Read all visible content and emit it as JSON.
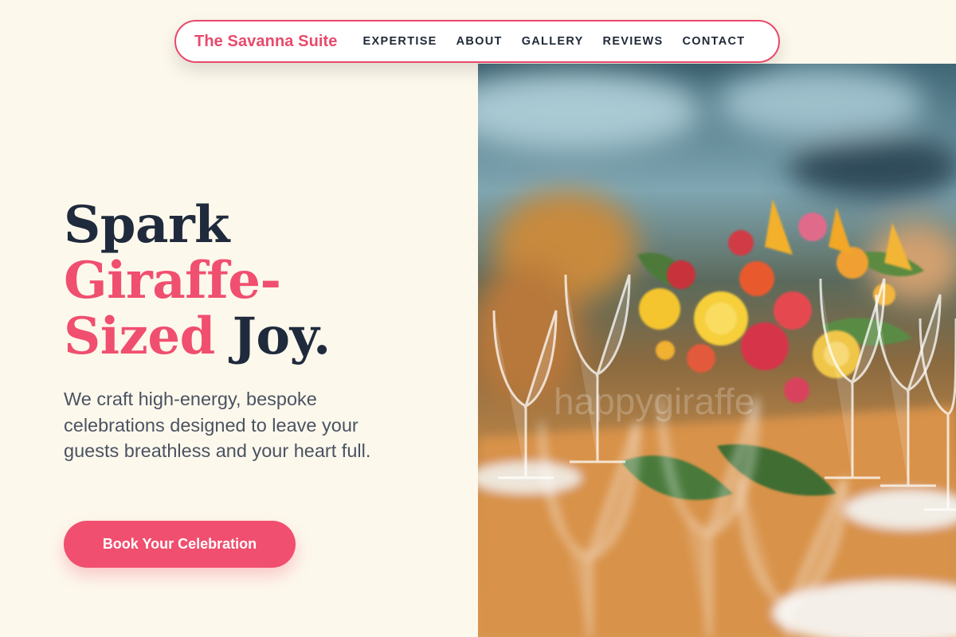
{
  "header": {
    "brand": "The Savanna Suite",
    "nav": [
      {
        "label": "EXPERTISE"
      },
      {
        "label": "ABOUT"
      },
      {
        "label": "GALLERY"
      },
      {
        "label": "REVIEWS"
      },
      {
        "label": "CONTACT"
      }
    ]
  },
  "hero": {
    "headline_line1": "Spark",
    "headline_accent1": "Giraffe-",
    "headline_accent2": "Sized",
    "headline_end": "Joy.",
    "description": "We craft high-energy, bespoke celebrations designed to leave your guests breathless and your heart full.",
    "cta_label": "Book Your Celebration",
    "image_watermark": "happygiraffe"
  },
  "colors": {
    "accent": "#f04f6f",
    "heading": "#1f2a3c",
    "background": "#fdf8ec"
  }
}
